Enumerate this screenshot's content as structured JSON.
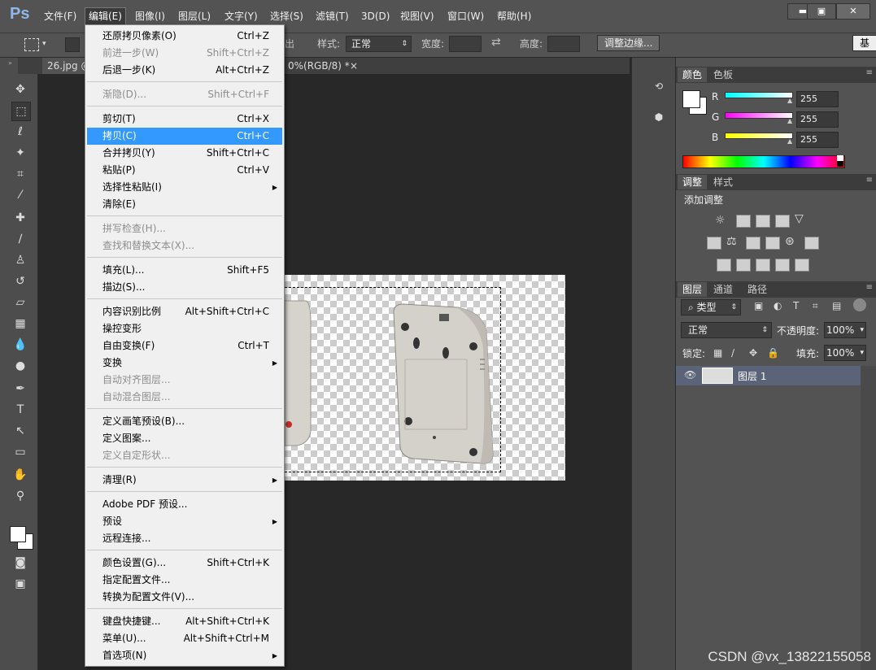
{
  "app": {
    "logo": "Ps"
  },
  "menubar": {
    "items": [
      "文件(F)",
      "编辑(E)",
      "图像(I)",
      "图层(L)",
      "文字(Y)",
      "选择(S)",
      "滤镜(T)",
      "3D(D)",
      "视图(V)",
      "窗口(W)",
      "帮助(H)"
    ],
    "window_buttons": {
      "minimize": "▬",
      "maximize": "▣",
      "close": "✕"
    }
  },
  "options": {
    "feather_partial": "出",
    "style_label": "样式:",
    "style_value": "正常",
    "width_label": "宽度:",
    "height_label": "高度:",
    "refine_edge": "调整边缘...",
    "workspace": "基"
  },
  "tabs": {
    "doc1": "26.jpg @",
    "doc2": "0%(RGB/8) *",
    "doc2_close": "×"
  },
  "edit_menu": {
    "items": [
      {
        "label": "还原拷贝像素(O)",
        "shortcut": "Ctrl+Z"
      },
      {
        "label": "前进一步(W)",
        "shortcut": "Shift+Ctrl+Z",
        "disabled": true
      },
      {
        "label": "后退一步(K)",
        "shortcut": "Alt+Ctrl+Z"
      },
      {
        "label": "渐隐(D)...",
        "shortcut": "Shift+Ctrl+F",
        "disabled": true
      },
      {
        "label": "剪切(T)",
        "shortcut": "Ctrl+X"
      },
      {
        "label": "拷贝(C)",
        "shortcut": "Ctrl+C",
        "highlight": true
      },
      {
        "label": "合并拷贝(Y)",
        "shortcut": "Shift+Ctrl+C"
      },
      {
        "label": "粘贴(P)",
        "shortcut": "Ctrl+V"
      },
      {
        "label": "选择性粘贴(I)",
        "shortcut": "",
        "submenu": true
      },
      {
        "label": "清除(E)",
        "shortcut": ""
      },
      {
        "label": "拼写检查(H)...",
        "shortcut": "",
        "disabled": true
      },
      {
        "label": "查找和替换文本(X)...",
        "shortcut": "",
        "disabled": true
      },
      {
        "label": "填充(L)...",
        "shortcut": "Shift+F5"
      },
      {
        "label": "描边(S)...",
        "shortcut": ""
      },
      {
        "label": "内容识别比例",
        "shortcut": "Alt+Shift+Ctrl+C"
      },
      {
        "label": "操控变形",
        "shortcut": ""
      },
      {
        "label": "自由变换(F)",
        "shortcut": "Ctrl+T"
      },
      {
        "label": "变换",
        "shortcut": "",
        "submenu": true
      },
      {
        "label": "自动对齐图层...",
        "shortcut": "",
        "disabled": true
      },
      {
        "label": "自动混合图层...",
        "shortcut": "",
        "disabled": true
      },
      {
        "label": "定义画笔预设(B)...",
        "shortcut": ""
      },
      {
        "label": "定义图案...",
        "shortcut": ""
      },
      {
        "label": "定义自定形状...",
        "shortcut": "",
        "disabled": true
      },
      {
        "label": "清理(R)",
        "shortcut": "",
        "submenu": true
      },
      {
        "label": "Adobe PDF 预设...",
        "shortcut": ""
      },
      {
        "label": "预设",
        "shortcut": "",
        "submenu": true
      },
      {
        "label": "远程连接...",
        "shortcut": ""
      },
      {
        "label": "颜色设置(G)...",
        "shortcut": "Shift+Ctrl+K"
      },
      {
        "label": "指定配置文件...",
        "shortcut": ""
      },
      {
        "label": "转换为配置文件(V)...",
        "shortcut": ""
      },
      {
        "label": "键盘快捷键...",
        "shortcut": "Alt+Shift+Ctrl+K"
      },
      {
        "label": "菜单(U)...",
        "shortcut": "Alt+Shift+Ctrl+M"
      },
      {
        "label": "首选项(N)",
        "shortcut": "",
        "submenu": true
      }
    ]
  },
  "color_panel": {
    "tabs": [
      "颜色",
      "色板"
    ],
    "channels": [
      {
        "name": "R",
        "value": "255",
        "gradient": "linear-gradient(to right,#00ffff,#ffffff)"
      },
      {
        "name": "G",
        "value": "255",
        "gradient": "linear-gradient(to right,#ff00ff,#ffffff)"
      },
      {
        "name": "B",
        "value": "255",
        "gradient": "linear-gradient(to right,#ffff00,#ffffff)"
      }
    ]
  },
  "adjust_panel": {
    "tabs": [
      "调整",
      "样式"
    ],
    "title": "添加调整"
  },
  "layers_panel": {
    "tabs": [
      "图层",
      "通道",
      "路径"
    ],
    "filter_kind": "类型",
    "blend_mode": "正常",
    "opacity_label": "不透明度:",
    "opacity_value": "100%",
    "lock_label": "锁定:",
    "fill_label": "填充:",
    "fill_value": "100%",
    "layers": [
      {
        "name": "图层 1"
      }
    ]
  },
  "watermark": "CSDN @vx_13822155058"
}
